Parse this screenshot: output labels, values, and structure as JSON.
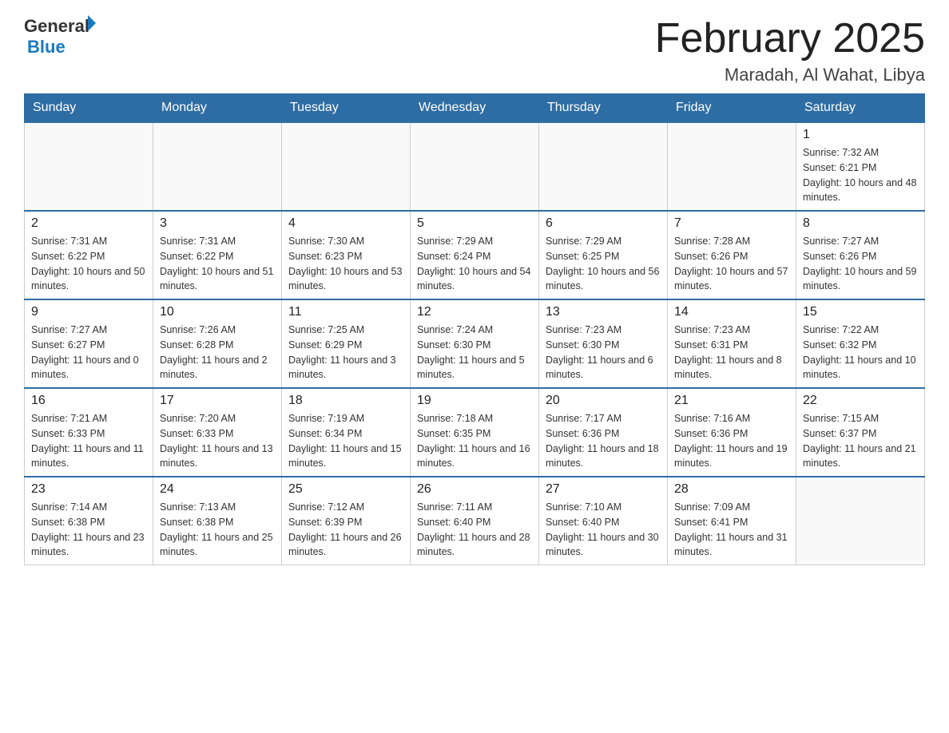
{
  "header": {
    "logo_general": "General",
    "logo_blue": "Blue",
    "month_title": "February 2025",
    "location": "Maradah, Al Wahat, Libya"
  },
  "days_of_week": [
    "Sunday",
    "Monday",
    "Tuesday",
    "Wednesday",
    "Thursday",
    "Friday",
    "Saturday"
  ],
  "weeks": [
    [
      {
        "day": "",
        "sunrise": "",
        "sunset": "",
        "daylight": ""
      },
      {
        "day": "",
        "sunrise": "",
        "sunset": "",
        "daylight": ""
      },
      {
        "day": "",
        "sunrise": "",
        "sunset": "",
        "daylight": ""
      },
      {
        "day": "",
        "sunrise": "",
        "sunset": "",
        "daylight": ""
      },
      {
        "day": "",
        "sunrise": "",
        "sunset": "",
        "daylight": ""
      },
      {
        "day": "",
        "sunrise": "",
        "sunset": "",
        "daylight": ""
      },
      {
        "day": "1",
        "sunrise": "Sunrise: 7:32 AM",
        "sunset": "Sunset: 6:21 PM",
        "daylight": "Daylight: 10 hours and 48 minutes."
      }
    ],
    [
      {
        "day": "2",
        "sunrise": "Sunrise: 7:31 AM",
        "sunset": "Sunset: 6:22 PM",
        "daylight": "Daylight: 10 hours and 50 minutes."
      },
      {
        "day": "3",
        "sunrise": "Sunrise: 7:31 AM",
        "sunset": "Sunset: 6:22 PM",
        "daylight": "Daylight: 10 hours and 51 minutes."
      },
      {
        "day": "4",
        "sunrise": "Sunrise: 7:30 AM",
        "sunset": "Sunset: 6:23 PM",
        "daylight": "Daylight: 10 hours and 53 minutes."
      },
      {
        "day": "5",
        "sunrise": "Sunrise: 7:29 AM",
        "sunset": "Sunset: 6:24 PM",
        "daylight": "Daylight: 10 hours and 54 minutes."
      },
      {
        "day": "6",
        "sunrise": "Sunrise: 7:29 AM",
        "sunset": "Sunset: 6:25 PM",
        "daylight": "Daylight: 10 hours and 56 minutes."
      },
      {
        "day": "7",
        "sunrise": "Sunrise: 7:28 AM",
        "sunset": "Sunset: 6:26 PM",
        "daylight": "Daylight: 10 hours and 57 minutes."
      },
      {
        "day": "8",
        "sunrise": "Sunrise: 7:27 AM",
        "sunset": "Sunset: 6:26 PM",
        "daylight": "Daylight: 10 hours and 59 minutes."
      }
    ],
    [
      {
        "day": "9",
        "sunrise": "Sunrise: 7:27 AM",
        "sunset": "Sunset: 6:27 PM",
        "daylight": "Daylight: 11 hours and 0 minutes."
      },
      {
        "day": "10",
        "sunrise": "Sunrise: 7:26 AM",
        "sunset": "Sunset: 6:28 PM",
        "daylight": "Daylight: 11 hours and 2 minutes."
      },
      {
        "day": "11",
        "sunrise": "Sunrise: 7:25 AM",
        "sunset": "Sunset: 6:29 PM",
        "daylight": "Daylight: 11 hours and 3 minutes."
      },
      {
        "day": "12",
        "sunrise": "Sunrise: 7:24 AM",
        "sunset": "Sunset: 6:30 PM",
        "daylight": "Daylight: 11 hours and 5 minutes."
      },
      {
        "day": "13",
        "sunrise": "Sunrise: 7:23 AM",
        "sunset": "Sunset: 6:30 PM",
        "daylight": "Daylight: 11 hours and 6 minutes."
      },
      {
        "day": "14",
        "sunrise": "Sunrise: 7:23 AM",
        "sunset": "Sunset: 6:31 PM",
        "daylight": "Daylight: 11 hours and 8 minutes."
      },
      {
        "day": "15",
        "sunrise": "Sunrise: 7:22 AM",
        "sunset": "Sunset: 6:32 PM",
        "daylight": "Daylight: 11 hours and 10 minutes."
      }
    ],
    [
      {
        "day": "16",
        "sunrise": "Sunrise: 7:21 AM",
        "sunset": "Sunset: 6:33 PM",
        "daylight": "Daylight: 11 hours and 11 minutes."
      },
      {
        "day": "17",
        "sunrise": "Sunrise: 7:20 AM",
        "sunset": "Sunset: 6:33 PM",
        "daylight": "Daylight: 11 hours and 13 minutes."
      },
      {
        "day": "18",
        "sunrise": "Sunrise: 7:19 AM",
        "sunset": "Sunset: 6:34 PM",
        "daylight": "Daylight: 11 hours and 15 minutes."
      },
      {
        "day": "19",
        "sunrise": "Sunrise: 7:18 AM",
        "sunset": "Sunset: 6:35 PM",
        "daylight": "Daylight: 11 hours and 16 minutes."
      },
      {
        "day": "20",
        "sunrise": "Sunrise: 7:17 AM",
        "sunset": "Sunset: 6:36 PM",
        "daylight": "Daylight: 11 hours and 18 minutes."
      },
      {
        "day": "21",
        "sunrise": "Sunrise: 7:16 AM",
        "sunset": "Sunset: 6:36 PM",
        "daylight": "Daylight: 11 hours and 19 minutes."
      },
      {
        "day": "22",
        "sunrise": "Sunrise: 7:15 AM",
        "sunset": "Sunset: 6:37 PM",
        "daylight": "Daylight: 11 hours and 21 minutes."
      }
    ],
    [
      {
        "day": "23",
        "sunrise": "Sunrise: 7:14 AM",
        "sunset": "Sunset: 6:38 PM",
        "daylight": "Daylight: 11 hours and 23 minutes."
      },
      {
        "day": "24",
        "sunrise": "Sunrise: 7:13 AM",
        "sunset": "Sunset: 6:38 PM",
        "daylight": "Daylight: 11 hours and 25 minutes."
      },
      {
        "day": "25",
        "sunrise": "Sunrise: 7:12 AM",
        "sunset": "Sunset: 6:39 PM",
        "daylight": "Daylight: 11 hours and 26 minutes."
      },
      {
        "day": "26",
        "sunrise": "Sunrise: 7:11 AM",
        "sunset": "Sunset: 6:40 PM",
        "daylight": "Daylight: 11 hours and 28 minutes."
      },
      {
        "day": "27",
        "sunrise": "Sunrise: 7:10 AM",
        "sunset": "Sunset: 6:40 PM",
        "daylight": "Daylight: 11 hours and 30 minutes."
      },
      {
        "day": "28",
        "sunrise": "Sunrise: 7:09 AM",
        "sunset": "Sunset: 6:41 PM",
        "daylight": "Daylight: 11 hours and 31 minutes."
      },
      {
        "day": "",
        "sunrise": "",
        "sunset": "",
        "daylight": ""
      }
    ]
  ]
}
